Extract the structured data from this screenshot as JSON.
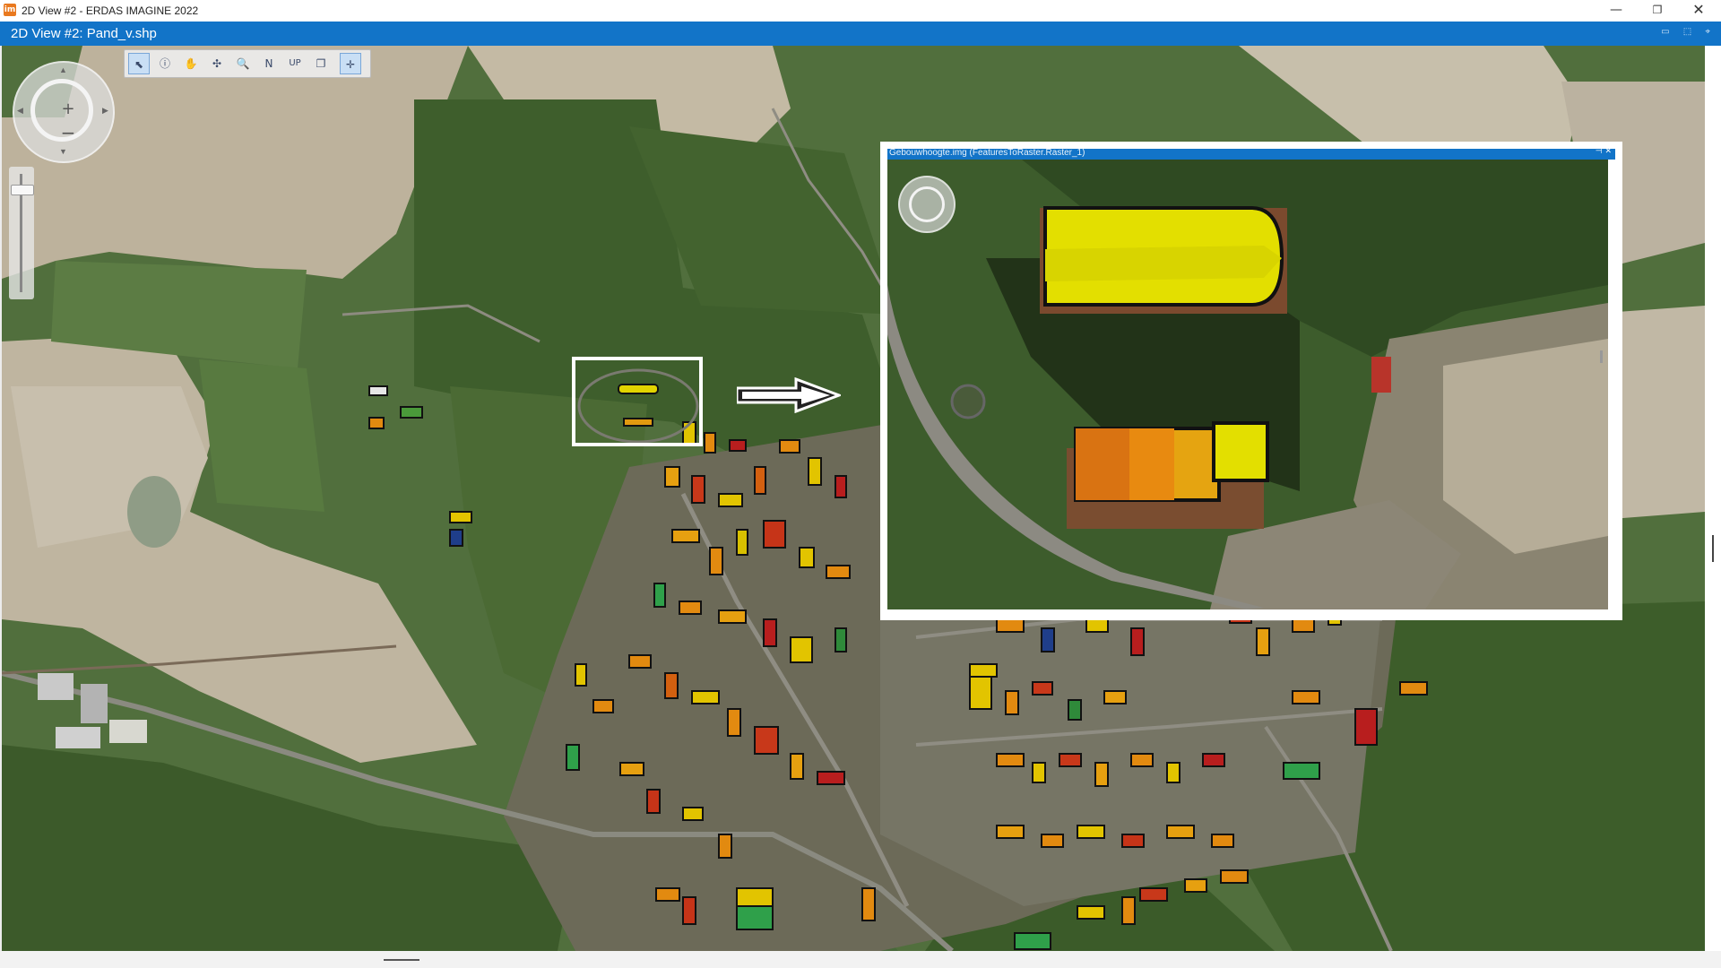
{
  "window": {
    "app_title": "2D View #2 - ERDAS IMAGINE 2022",
    "app_icon_text": "im",
    "controls": {
      "minimize": "—",
      "maximize": "❐",
      "close": "✕"
    }
  },
  "view": {
    "title": "2D View #2: Pand_v.shp",
    "header_controls": "▭ ⬚ ⌖"
  },
  "navigation": {
    "zoom_in": "+",
    "zoom_out": "−",
    "arrows": {
      "north": "▲",
      "south": "▼",
      "west": "◀",
      "east": "▶"
    }
  },
  "toolbar": {
    "tools": [
      {
        "name": "select-tool",
        "glyph": "⬉",
        "active": true
      },
      {
        "name": "info-tool",
        "glyph": "ⓘ",
        "active": false
      },
      {
        "name": "pan-tool",
        "glyph": "✋",
        "active": false
      },
      {
        "name": "fit-tool",
        "glyph": "✣",
        "active": false
      },
      {
        "name": "zoom-tool",
        "glyph": "🔍",
        "active": false
      },
      {
        "name": "north-up-tool",
        "glyph": "N",
        "active": false
      },
      {
        "name": "up-tool",
        "glyph": "UP",
        "active": false
      },
      {
        "name": "layers-tool",
        "glyph": "❐",
        "active": false
      },
      {
        "name": "crosshair-tool",
        "glyph": "✛",
        "active": true
      }
    ]
  },
  "inset": {
    "title": "Gebouwhoogte.img (FeaturesToRaster.Raster_1)",
    "pin": "⊣ ✕"
  },
  "colors": {
    "accent_blue": "#1274c8",
    "height_high": "#e6e600",
    "height_mid": "#e28a10",
    "height_low": "#b81e1e",
    "field_green": "#3f5f2f",
    "field_beige": "#bfb6a2"
  }
}
